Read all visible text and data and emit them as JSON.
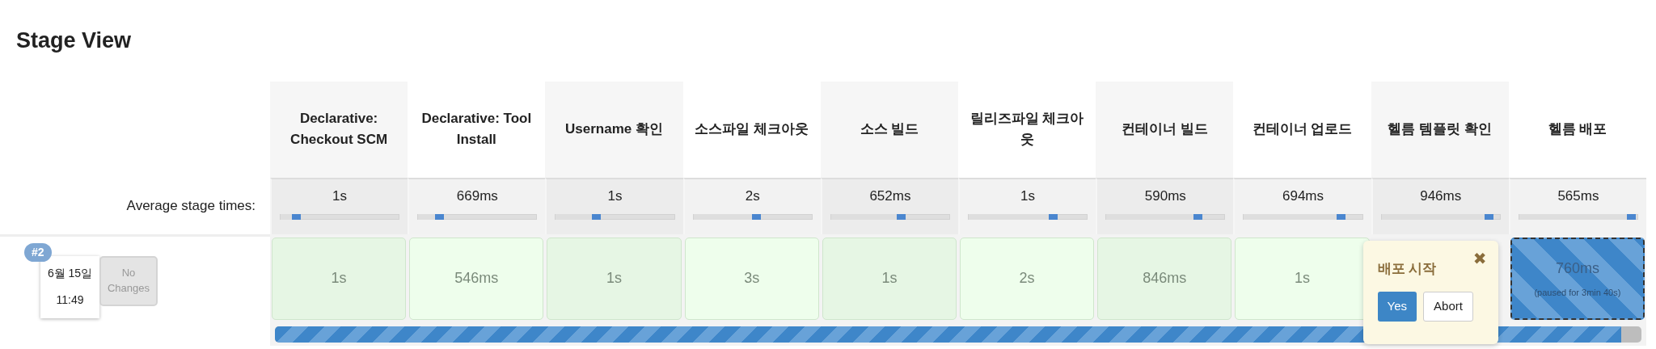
{
  "title": "Stage View",
  "average_label": "Average stage times:",
  "stages": [
    {
      "name": "Declarative: Checkout SCM",
      "average": "1s",
      "level": 0.17
    },
    {
      "name": "Declarative: Tool Install",
      "average": "669ms",
      "level": 0.22
    },
    {
      "name": "Username 확인",
      "average": "1s",
      "level": 0.38
    },
    {
      "name": "소스파일 체크아웃",
      "average": "2s",
      "level": 0.57
    },
    {
      "name": "소스 빌드",
      "average": "652ms",
      "level": 0.63
    },
    {
      "name": "릴리즈파일 체크아웃",
      "average": "1s",
      "level": 0.75
    },
    {
      "name": "컨테이너 빌드",
      "average": "590ms",
      "level": 0.81
    },
    {
      "name": "컨테이너 업로드",
      "average": "694ms",
      "level": 0.86
    },
    {
      "name": "헬름 템플릿 확인",
      "average": "946ms",
      "level": 0.95
    },
    {
      "name": "헬름 배포",
      "average": "565ms",
      "level": 0.99
    }
  ],
  "builds": [
    {
      "number": "#2",
      "date": "6월 15일",
      "time": "11:49",
      "changes": "No Changes",
      "cells": [
        {
          "kind": "success",
          "duration": "1s"
        },
        {
          "kind": "success",
          "duration": "546ms"
        },
        {
          "kind": "success",
          "duration": "1s"
        },
        {
          "kind": "success",
          "duration": "3s"
        },
        {
          "kind": "success",
          "duration": "1s"
        },
        {
          "kind": "success",
          "duration": "2s"
        },
        {
          "kind": "success",
          "duration": "846ms"
        },
        {
          "kind": "success",
          "duration": "1s"
        },
        {
          "kind": "input",
          "popover": {
            "title": "배포 시작",
            "close": "✖",
            "buttons": [
              "Yes",
              "Abort"
            ]
          }
        },
        {
          "kind": "paused",
          "duration": "760ms",
          "note": "(paused for 3min 40s)"
        }
      ],
      "progress": {
        "level": 0.985
      }
    }
  ]
}
